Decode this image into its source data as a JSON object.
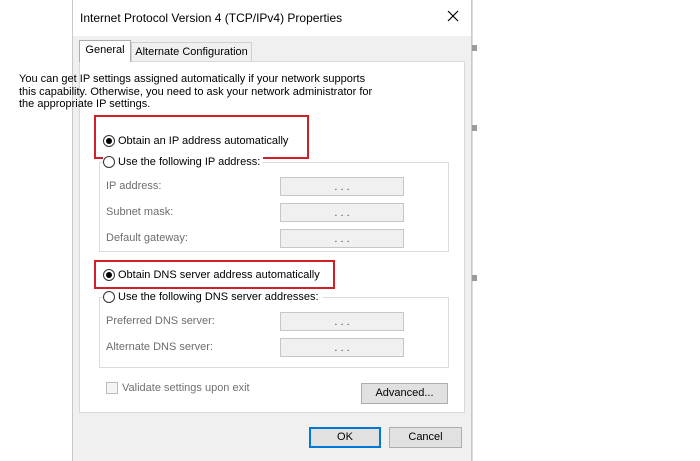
{
  "window": {
    "title": "Internet Protocol Version 4 (TCP/IPv4) Properties"
  },
  "tabs": [
    {
      "label": "General",
      "active": true
    },
    {
      "label": "Alternate Configuration",
      "active": false
    }
  ],
  "intro_text": "You can get IP settings assigned automatically if your network supports this capability. Otherwise, you need to ask your network administrator for the appropriate IP settings.",
  "ip_section": {
    "auto_label": "Obtain an IP address automatically",
    "auto_selected": true,
    "manual_label": "Use the following IP address:",
    "fields": [
      {
        "label": "IP address:",
        "value": ". . ."
      },
      {
        "label": "Subnet mask:",
        "value": ". . ."
      },
      {
        "label": "Default gateway:",
        "value": ". . ."
      }
    ]
  },
  "dns_section": {
    "auto_label": "Obtain DNS server address automatically",
    "auto_selected": true,
    "manual_label": "Use the following DNS server addresses:",
    "fields": [
      {
        "label": "Preferred DNS server:",
        "value": ". . ."
      },
      {
        "label": "Alternate DNS server:",
        "value": ". . ."
      }
    ]
  },
  "validate_label": "Validate settings upon exit",
  "buttons": {
    "advanced": "Advanced...",
    "ok": "OK",
    "cancel": "Cancel"
  },
  "colors": {
    "highlight": "#d21f26",
    "default_button_border": "#0078d7",
    "dialog_bg": "#f0f0f0"
  }
}
